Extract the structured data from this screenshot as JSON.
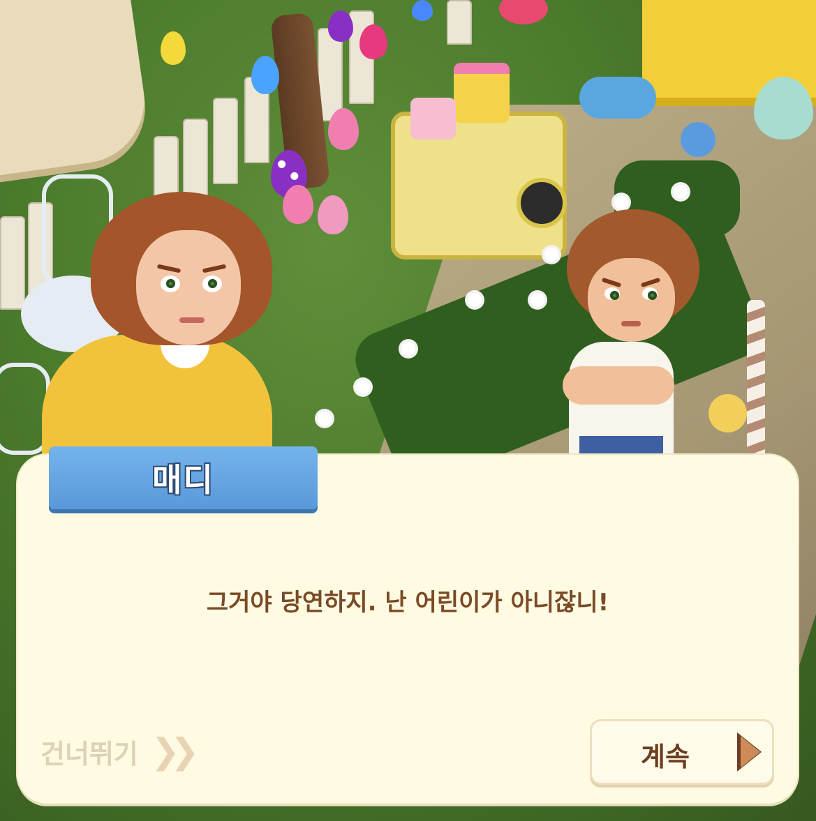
{
  "dialog": {
    "speaker_name": "매디",
    "text": "그거야 당연하지. 난 어린이가 아니잖니!"
  },
  "controls": {
    "skip_label": "건너뛰기",
    "skip_icon": "double-chevron-right-icon",
    "continue_label": "계속",
    "continue_icon": "play-triangle-icon"
  },
  "colors": {
    "dialog_background": "#fefbe2",
    "name_tab": "#6aa8e4",
    "dialog_text": "#7a4a26",
    "skip_text": "#ddd1b7",
    "continue_arrow": "#cd8b57"
  }
}
